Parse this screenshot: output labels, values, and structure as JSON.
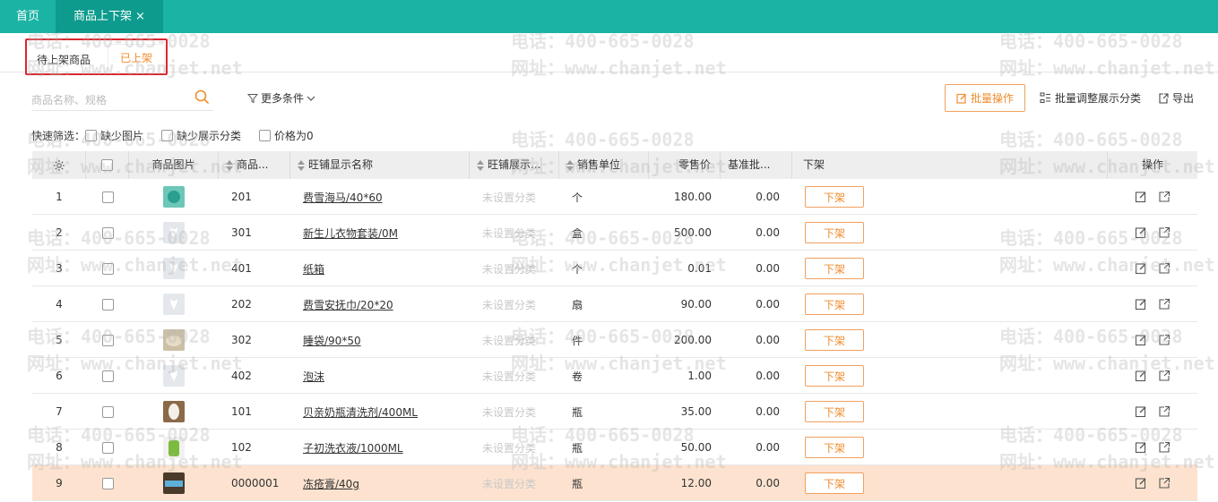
{
  "tabs": {
    "home": "首页",
    "active": "商品上下架",
    "close": "×"
  },
  "subtabs": {
    "pending": "待上架商品",
    "listed": "已上架"
  },
  "search": {
    "placeholder": "商品名称、规格"
  },
  "toolbar": {
    "more_conditions": "更多条件",
    "batch_ops": "批量操作",
    "batch_category": "批量调整展示分类",
    "export": "导出"
  },
  "quick_filter": {
    "label": "快速筛选：",
    "options": [
      "缺少图片",
      "缺少展示分类",
      "价格为0"
    ]
  },
  "table": {
    "headers": [
      "商品图片",
      "商品...",
      "旺铺显示名称",
      "旺铺展示...",
      "销售单位",
      "零售价",
      "基准批...",
      "下架",
      "操作"
    ],
    "rows": [
      {
        "idx": "1",
        "code": "201",
        "name": "费雪海马/40*60",
        "category": "未设置分类",
        "unit": "个",
        "price": "180.00",
        "base": "0.00",
        "action": "下架",
        "img": "photo-teal"
      },
      {
        "idx": "2",
        "code": "301",
        "name": "新生儿衣物套装/0M",
        "category": "未设置分类",
        "unit": "盒",
        "price": "500.00",
        "base": "0.00",
        "action": "下架",
        "img": "placeholder"
      },
      {
        "idx": "3",
        "code": "401",
        "name": "纸箱",
        "category": "未设置分类",
        "unit": "个",
        "price": "0.01",
        "base": "0.00",
        "action": "下架",
        "img": "placeholder"
      },
      {
        "idx": "4",
        "code": "202",
        "name": "费雪安抚巾/20*20",
        "category": "未设置分类",
        "unit": "扇",
        "price": "90.00",
        "base": "0.00",
        "action": "下架",
        "img": "placeholder"
      },
      {
        "idx": "5",
        "code": "302",
        "name": "睡袋/90*50",
        "category": "未设置分类",
        "unit": "件",
        "price": "200.00",
        "base": "0.00",
        "action": "下架",
        "img": "photo-beige"
      },
      {
        "idx": "6",
        "code": "402",
        "name": "泡沫",
        "category": "未设置分类",
        "unit": "卷",
        "price": "1.00",
        "base": "0.00",
        "action": "下架",
        "img": "placeholder"
      },
      {
        "idx": "7",
        "code": "101",
        "name": "贝亲奶瓶清洗剂/400ML",
        "category": "未设置分类",
        "unit": "瓶",
        "price": "35.00",
        "base": "0.00",
        "action": "下架",
        "img": "photo-bottle"
      },
      {
        "idx": "8",
        "code": "102",
        "name": "子初洗衣液/1000ML",
        "category": "未设置分类",
        "unit": "瓶",
        "price": "50.00",
        "base": "0.00",
        "action": "下架",
        "img": "photo-green"
      },
      {
        "idx": "9",
        "code": "0000001",
        "name": "冻疮膏/40g",
        "category": "未设置分类",
        "unit": "瓶",
        "price": "12.00",
        "base": "0.00",
        "action": "下架",
        "img": "photo-box"
      }
    ]
  },
  "watermark": {
    "phone": "电话：400-665-0028",
    "site": "网址：www.chanjet.net"
  },
  "colors": {
    "topbar": "#1bb3a3",
    "active_tab": "#0c9b8d",
    "accent": "#f08c2e",
    "highlight_row": "#fde3cf",
    "frame": "#d9282f"
  }
}
